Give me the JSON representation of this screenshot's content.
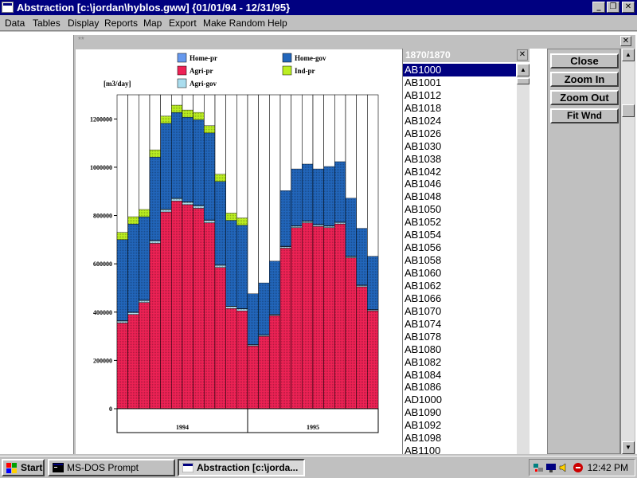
{
  "window": {
    "title": "Abstraction [c:\\jordan\\hyblos.gww] {01/01/94 - 12/31/95}",
    "minimize_glyph": "_",
    "maximize_glyph": "❐",
    "close_glyph": "✕"
  },
  "menu": {
    "items": [
      "Data",
      "Tables",
      "Display",
      "Reports",
      "Map",
      "Export",
      "Make Random",
      "Help"
    ]
  },
  "child_window": {
    "label": "**",
    "close_glyph": "✕"
  },
  "list": {
    "title": "1870/1870",
    "close_glyph": "✕",
    "selected_index": 0,
    "items": [
      "AB1000",
      "AB1001",
      "AB1012",
      "AB1018",
      "AB1024",
      "AB1026",
      "AB1030",
      "AB1038",
      "AB1042",
      "AB1046",
      "AB1048",
      "AB1050",
      "AB1052",
      "AB1054",
      "AB1056",
      "AB1058",
      "AB1060",
      "AB1062",
      "AB1066",
      "AB1070",
      "AB1074",
      "AB1078",
      "AB1080",
      "AB1082",
      "AB1084",
      "AB1086",
      "AD1000",
      "AB1090",
      "AB1092",
      "AB1098",
      "AB1100"
    ]
  },
  "buttons": {
    "close": "Close",
    "zoom_in": "Zoom In",
    "zoom_out": "Zoom Out",
    "fit": "Fit Wnd"
  },
  "taskbar": {
    "start": "Start",
    "tasks": [
      "MS-DOS Prompt",
      "Abstraction [c:\\jorda..."
    ],
    "clock": "12:42 PM"
  },
  "chart_data": {
    "type": "bar",
    "stacked": true,
    "ylabel": "[m3/day]",
    "ylim": [
      0,
      1300000
    ],
    "yticks": [
      0,
      200000,
      400000,
      600000,
      800000,
      1000000,
      1200000
    ],
    "ytick_labels": [
      "0",
      "200000",
      "400000",
      "600000",
      "800000",
      "1000000",
      "1200000"
    ],
    "groups": [
      "1994",
      "1995"
    ],
    "bars_per_group": 12,
    "series": [
      {
        "name": "Agri-pr",
        "color": "#ee2255",
        "values": [
          355000,
          390000,
          440000,
          685000,
          815000,
          860000,
          845000,
          830000,
          770000,
          585000,
          415000,
          405000,
          260000,
          300000,
          385000,
          665000,
          750000,
          770000,
          755000,
          750000,
          765000,
          625000,
          505000,
          405000
        ]
      },
      {
        "name": "Agri-gov",
        "color": "#aaddee",
        "values": [
          8000,
          8000,
          8000,
          10000,
          10000,
          10000,
          10000,
          10000,
          10000,
          9000,
          8000,
          8000,
          4000,
          4000,
          4000,
          6000,
          6000,
          6000,
          6000,
          6000,
          6000,
          5000,
          5000,
          4000
        ]
      },
      {
        "name": "Home-pr",
        "color": "#6699ee",
        "values": [
          2000,
          2000,
          2000,
          2000,
          2000,
          2000,
          2000,
          2000,
          2000,
          2000,
          2000,
          2000,
          2000,
          2000,
          2000,
          2000,
          2000,
          2000,
          2000,
          2000,
          2000,
          2000,
          2000,
          2000
        ]
      },
      {
        "name": "Home-gov",
        "color": "#2266bb",
        "values": [
          335000,
          365000,
          345000,
          345000,
          355000,
          355000,
          350000,
          355000,
          360000,
          345000,
          355000,
          345000,
          210000,
          215000,
          220000,
          230000,
          235000,
          235000,
          230000,
          245000,
          250000,
          240000,
          235000,
          220000
        ]
      },
      {
        "name": "Ind-pr",
        "color": "#bbee22",
        "values": [
          30000,
          30000,
          30000,
          30000,
          30000,
          30000,
          30000,
          30000,
          30000,
          30000,
          30000,
          30000,
          0,
          0,
          0,
          0,
          0,
          0,
          0,
          0,
          0,
          0,
          0,
          0
        ]
      }
    ]
  }
}
